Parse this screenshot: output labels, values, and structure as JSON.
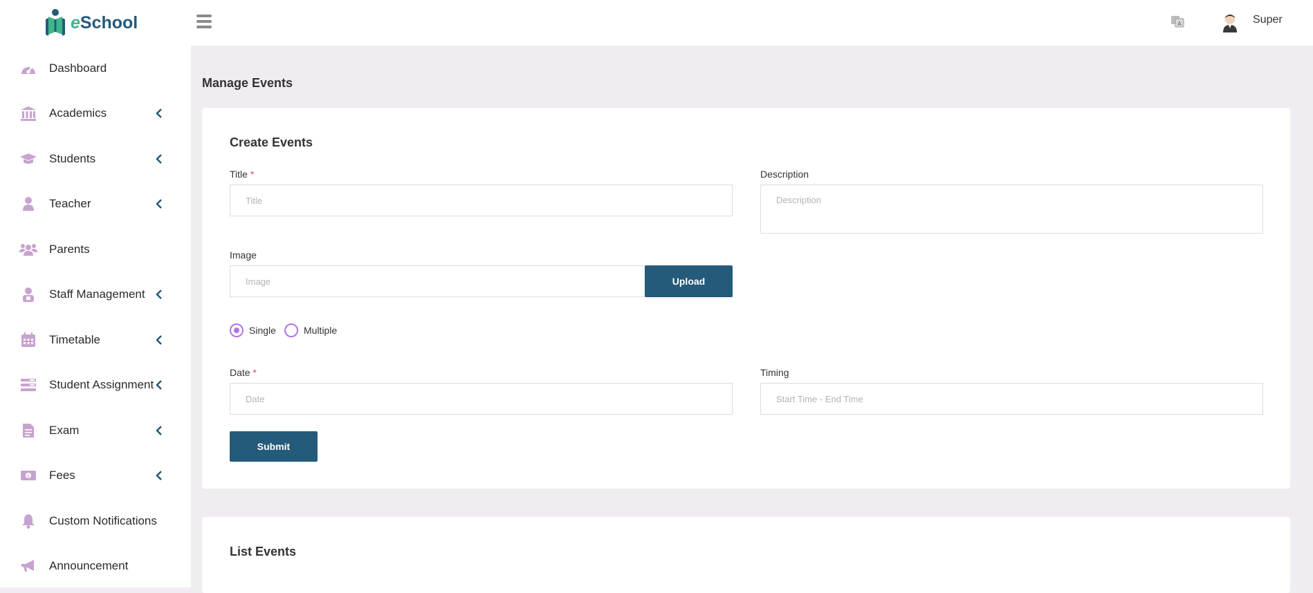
{
  "app": {
    "logo_text_e": "e",
    "logo_text_rest": "School"
  },
  "sidebar": {
    "items": [
      {
        "label": "Dashboard",
        "icon": "dashboard-icon",
        "has_submenu": false
      },
      {
        "label": "Academics",
        "icon": "bank-icon",
        "has_submenu": true
      },
      {
        "label": "Students",
        "icon": "graduation-cap-icon",
        "has_submenu": true
      },
      {
        "label": "Teacher",
        "icon": "user-icon",
        "has_submenu": true
      },
      {
        "label": "Parents",
        "icon": "users-icon",
        "has_submenu": false
      },
      {
        "label": "Staff Management",
        "icon": "staff-icon",
        "has_submenu": true
      },
      {
        "label": "Timetable",
        "icon": "calendar-icon",
        "has_submenu": true
      },
      {
        "label": "Student Assignment",
        "icon": "assignment-icon",
        "has_submenu": true
      },
      {
        "label": "Exam",
        "icon": "document-icon",
        "has_submenu": true
      },
      {
        "label": "Fees",
        "icon": "money-icon",
        "has_submenu": true
      },
      {
        "label": "Custom Notifications",
        "icon": "bell-icon",
        "has_submenu": false
      },
      {
        "label": "Announcement",
        "icon": "megaphone-icon",
        "has_submenu": false
      }
    ]
  },
  "topbar": {
    "user_name": "Super"
  },
  "page": {
    "title": "Manage Events"
  },
  "create_form": {
    "title": "Create Events",
    "title_label": "Title",
    "title_placeholder": "Title",
    "description_label": "Description",
    "description_placeholder": "Description",
    "image_label": "Image",
    "image_placeholder": "Image",
    "upload_label": "Upload",
    "radio_single": "Single",
    "radio_multiple": "Multiple",
    "selected_radio": "Single",
    "date_label": "Date",
    "date_placeholder": "Date",
    "timing_label": "Timing",
    "timing_placeholder": "Start Time - End Time",
    "submit_label": "Submit",
    "required_mark": "*"
  },
  "list": {
    "title": "List Events"
  },
  "colors": {
    "accent": "#245a7a",
    "radio": "#b073e6",
    "icon": "#c7a3cf",
    "background": "#f1ecf1"
  }
}
